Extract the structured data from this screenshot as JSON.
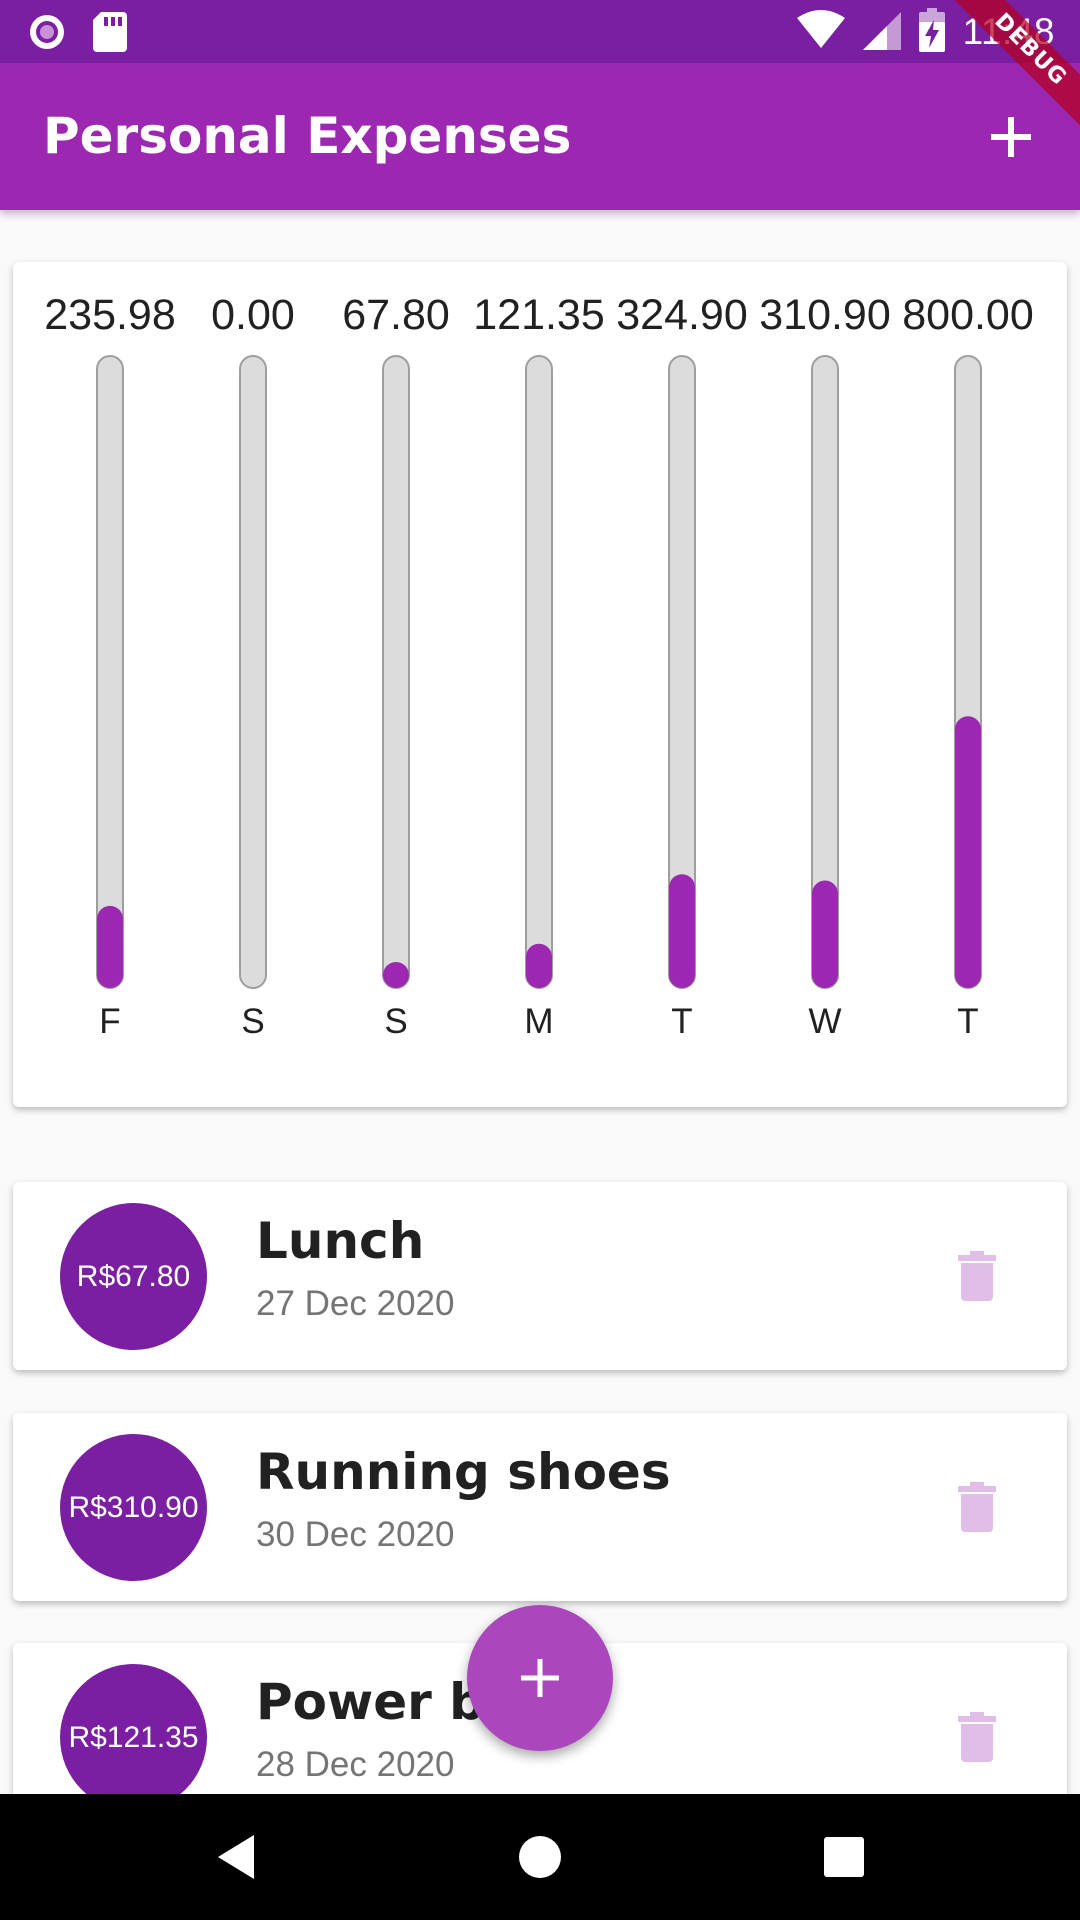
{
  "status_bar": {
    "time": "11:48",
    "icons": [
      "radio-button-icon",
      "sd-card-icon",
      "wifi-icon",
      "cell-signal-icon",
      "battery-charging-icon"
    ]
  },
  "debug_banner": {
    "label": "DEBUG"
  },
  "app_bar": {
    "title": "Personal Expenses",
    "add_icon": "plus-icon"
  },
  "colors": {
    "primary": "#9c27b0",
    "primary_dark": "#7b1fa2",
    "fab": "#ab47bc",
    "bar_fill": "#9c27b0",
    "bar_track": "#dcdcdc",
    "delete_icon": "#e1bee7"
  },
  "chart_data": {
    "type": "bar",
    "categories": [
      "F",
      "S",
      "S",
      "M",
      "T",
      "W",
      "T"
    ],
    "values": [
      235.98,
      0.0,
      67.8,
      121.35,
      324.9,
      310.9,
      800.0
    ],
    "value_labels": [
      "235.98",
      "0.00",
      "67.80",
      "121.35",
      "324.90",
      "310.90",
      "800.00"
    ],
    "fill_fraction": [
      0.13,
      0.0,
      0.04,
      0.07,
      0.18,
      0.17,
      0.43
    ],
    "title": "",
    "xlabel": "",
    "ylabel": ""
  },
  "transactions": [
    {
      "amount": "R$67.80",
      "title": "Lunch",
      "date": "27 Dec 2020"
    },
    {
      "amount": "R$310.90",
      "title": "Running shoes",
      "date": "30 Dec 2020"
    },
    {
      "amount": "R$121.35",
      "title": "Power bill",
      "date": "28 Dec 2020"
    }
  ],
  "fab": {
    "icon": "plus-icon"
  },
  "nav_bar": {
    "icons": [
      "back-icon",
      "home-icon",
      "recents-icon"
    ]
  }
}
